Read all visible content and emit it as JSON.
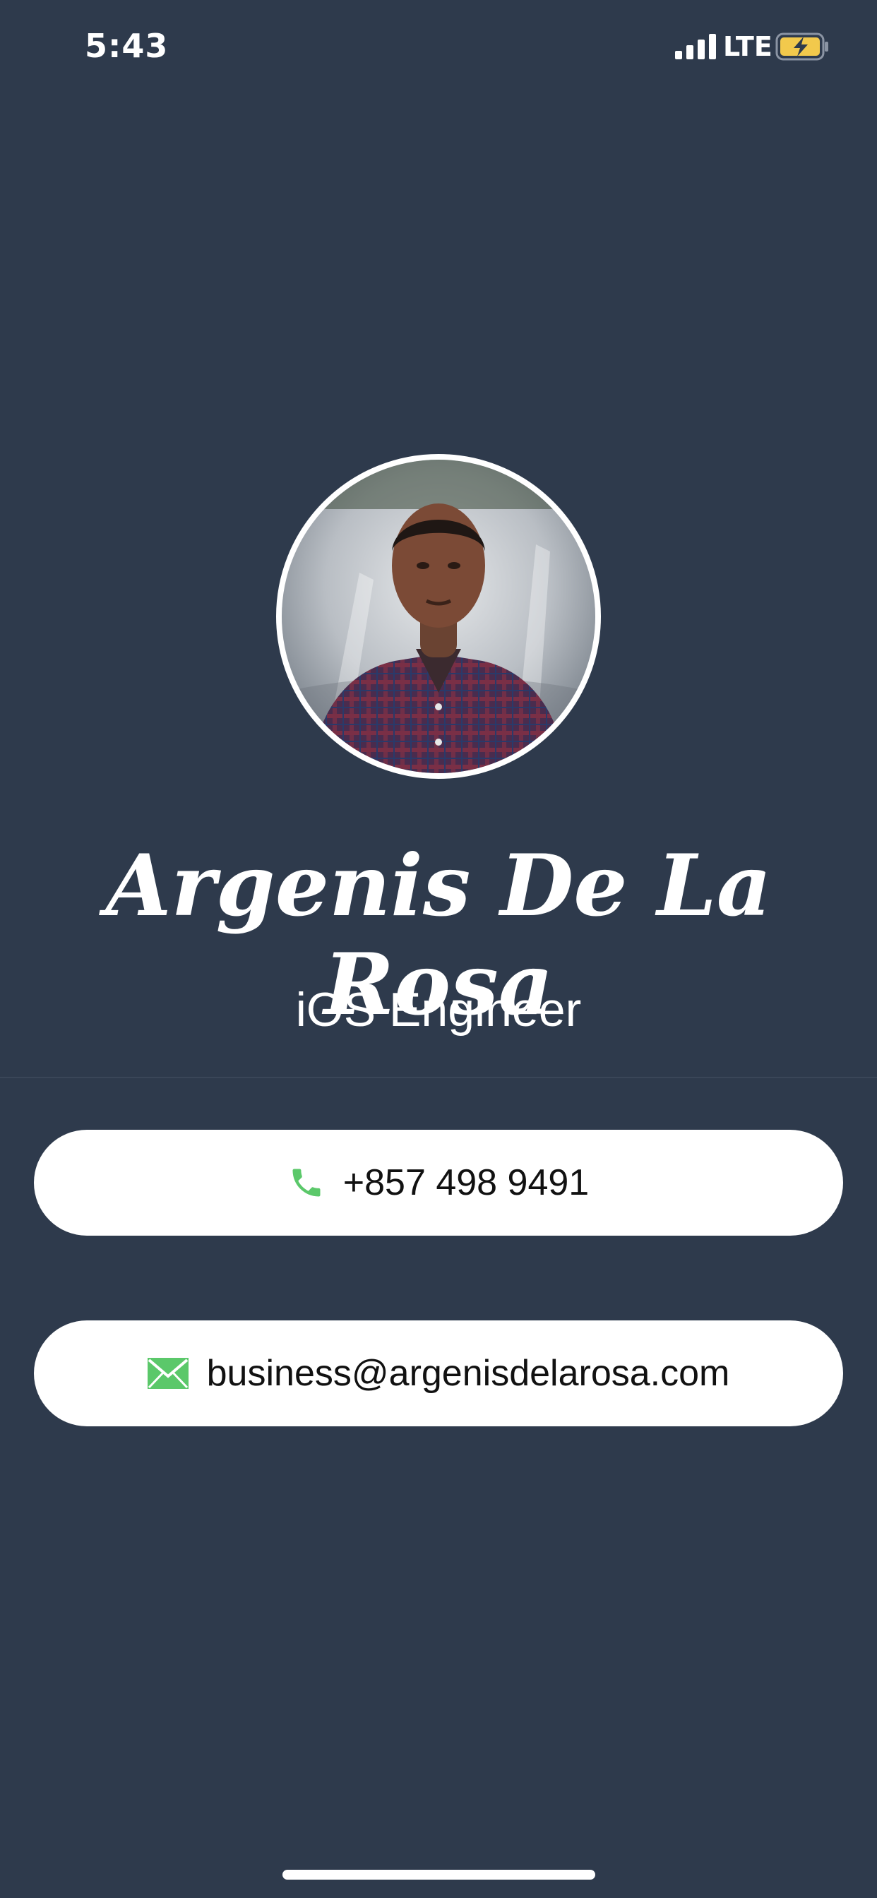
{
  "status_bar": {
    "time": "5:43",
    "network": "LTE",
    "signal_icon": "cellular-signal-icon",
    "battery_icon": "battery-charging-icon",
    "battery_color": "#F2C94C"
  },
  "profile": {
    "avatar_icon": "profile-photo",
    "name": "Argenis De La Rosa",
    "title": "iOS Engineer"
  },
  "contacts": {
    "phone": {
      "icon": "phone-icon",
      "icon_color": "#5BC86A",
      "value": "+857 498 9491"
    },
    "email": {
      "icon": "mail-icon",
      "icon_color": "#5BC86A",
      "value": "business@argenisdelarosa.com"
    }
  },
  "colors": {
    "background": "#2E3A4C",
    "card": "#FFFFFF",
    "text_light": "#FFFFFF",
    "text_dark": "#111111"
  }
}
